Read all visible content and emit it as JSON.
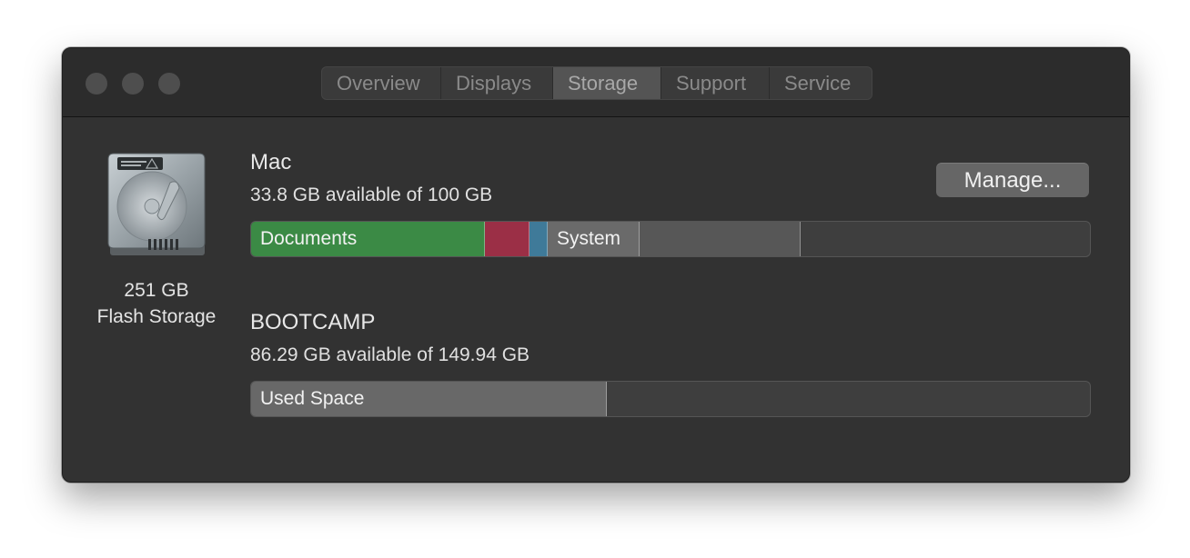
{
  "tabs": [
    {
      "label": "Overview",
      "selected": false
    },
    {
      "label": "Displays",
      "selected": false
    },
    {
      "label": "Storage",
      "selected": true
    },
    {
      "label": "Support",
      "selected": false
    },
    {
      "label": "Service",
      "selected": false
    }
  ],
  "disk": {
    "icon": "hard-drive-icon",
    "capacity": "251 GB",
    "type": "Flash Storage"
  },
  "volumes": [
    {
      "name": "Mac",
      "available": "33.8 GB available of 100 GB",
      "segments": [
        {
          "label": "Documents",
          "color": "#3b8a45",
          "fraction": 0.279
        },
        {
          "label": "",
          "color": "#9b2f46",
          "fraction": 0.053
        },
        {
          "label": "",
          "color": "#3f7a99",
          "fraction": 0.022
        },
        {
          "label": "System",
          "color": "#6a6a6a",
          "fraction": 0.11
        },
        {
          "label": "",
          "color": "#575757",
          "fraction": 0.192
        }
      ]
    },
    {
      "name": "BOOTCAMP",
      "available": "86.29 GB available of 149.94 GB",
      "segments": [
        {
          "label": "Used Space",
          "color": "#686868",
          "fraction": 0.424
        }
      ]
    }
  ],
  "manage_button": {
    "label": "Manage..."
  }
}
